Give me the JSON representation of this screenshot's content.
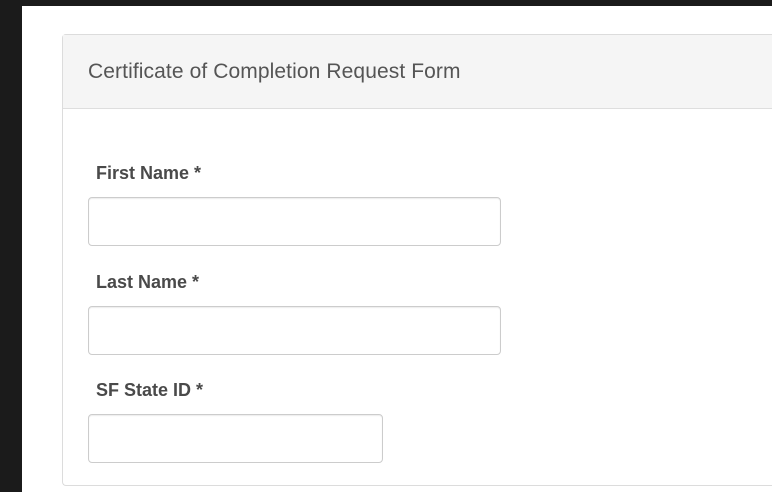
{
  "form": {
    "title": "Certificate of Completion Request Form",
    "fields": [
      {
        "label": "First Name *",
        "value": ""
      },
      {
        "label": "Last Name *",
        "value": ""
      },
      {
        "label": "SF State ID *",
        "value": ""
      }
    ]
  },
  "colors": {
    "page_background": "#1b1b1b",
    "panel_header_background": "#f5f5f5",
    "label_text": "#4a4a4a",
    "title_text": "#555555",
    "input_border": "#cccccc"
  }
}
